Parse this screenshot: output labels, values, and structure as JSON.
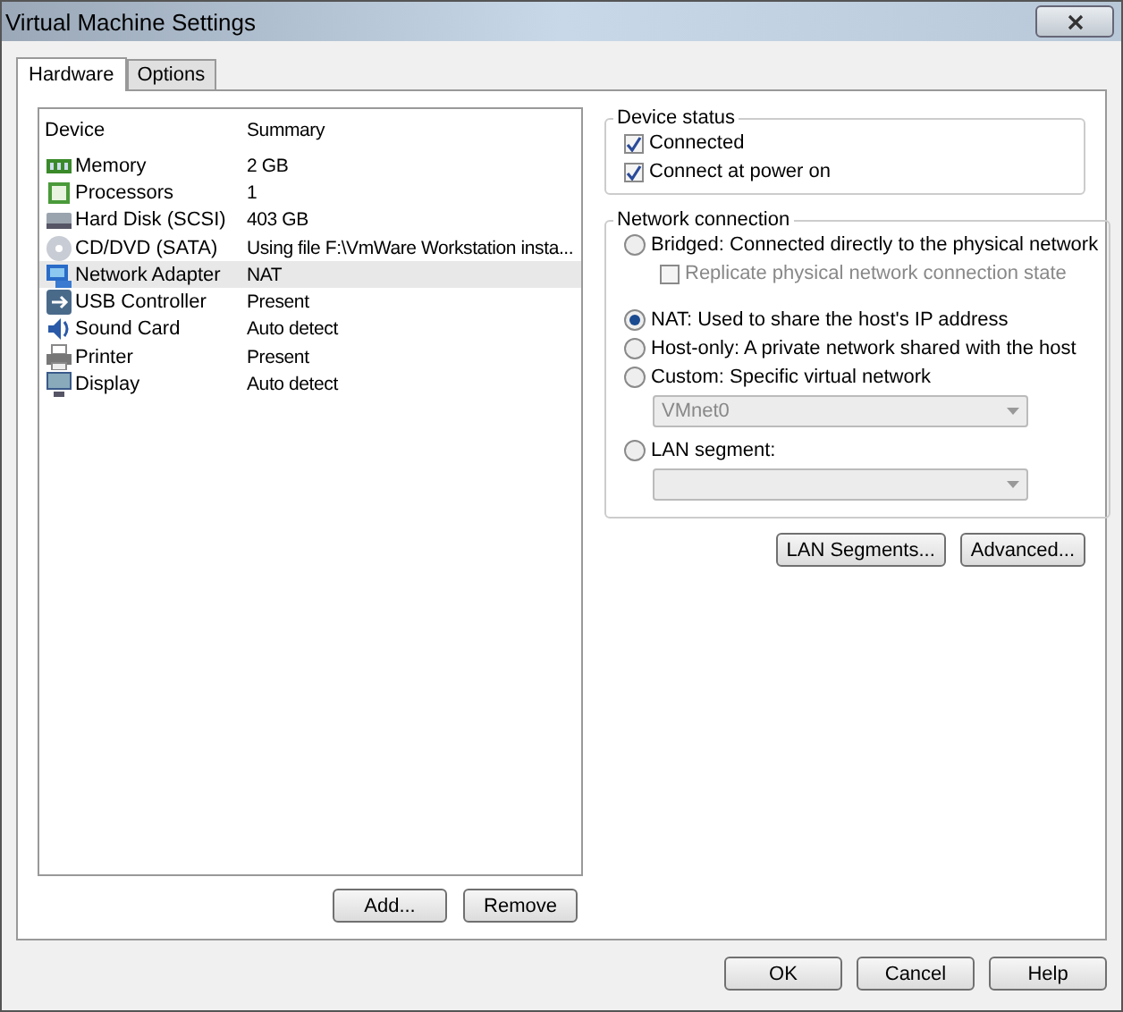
{
  "window": {
    "title": "Virtual Machine Settings"
  },
  "tabs": [
    {
      "label": "Hardware",
      "selected": true
    },
    {
      "label": "Options",
      "selected": false
    }
  ],
  "device_table": {
    "columns": [
      "Device",
      "Summary"
    ],
    "rows": [
      {
        "device": "Memory",
        "summary": "2 GB",
        "selected": false
      },
      {
        "device": "Processors",
        "summary": "1",
        "selected": false
      },
      {
        "device": "Hard Disk (SCSI)",
        "summary": "403 GB",
        "selected": false
      },
      {
        "device": "CD/DVD (SATA)",
        "summary": "Using file F:\\VmWare Workstation insta...",
        "selected": false
      },
      {
        "device": "Network Adapter",
        "summary": "NAT",
        "selected": true
      },
      {
        "device": "USB Controller",
        "summary": "Present",
        "selected": false
      },
      {
        "device": "Sound Card",
        "summary": "Auto detect",
        "selected": false
      },
      {
        "device": "Printer",
        "summary": "Present",
        "selected": false
      },
      {
        "device": "Display",
        "summary": "Auto detect",
        "selected": false
      }
    ]
  },
  "device_buttons": [
    "Add...",
    "Remove"
  ],
  "device_status": {
    "title": "Device status",
    "options": [
      {
        "label": "Connected",
        "checked": true
      },
      {
        "label": "Connect at power on",
        "checked": true
      }
    ]
  },
  "network_connection": {
    "title": "Network connection",
    "items": [
      {
        "kind": "radio",
        "label": "Bridged: Connected directly to the physical network",
        "selected": false
      },
      {
        "kind": "checkbox",
        "label": "Replicate physical network connection state",
        "checked": false,
        "disabled": true
      },
      {
        "kind": "radio",
        "label": "NAT: Used to share the host's IP address",
        "selected": true
      },
      {
        "kind": "radio",
        "label": "Host-only: A private network shared with the host",
        "selected": false
      },
      {
        "kind": "radio",
        "label": "Custom: Specific virtual network",
        "selected": false
      },
      {
        "kind": "select",
        "value": "VMnet0",
        "disabled": true
      },
      {
        "kind": "radio",
        "label": "LAN segment:",
        "selected": false
      },
      {
        "kind": "select",
        "disabled": true
      }
    ]
  },
  "network_buttons": [
    "LAN Segments...",
    "Advanced..."
  ],
  "dialog_buttons": [
    "OK",
    "Cancel",
    "Help"
  ]
}
